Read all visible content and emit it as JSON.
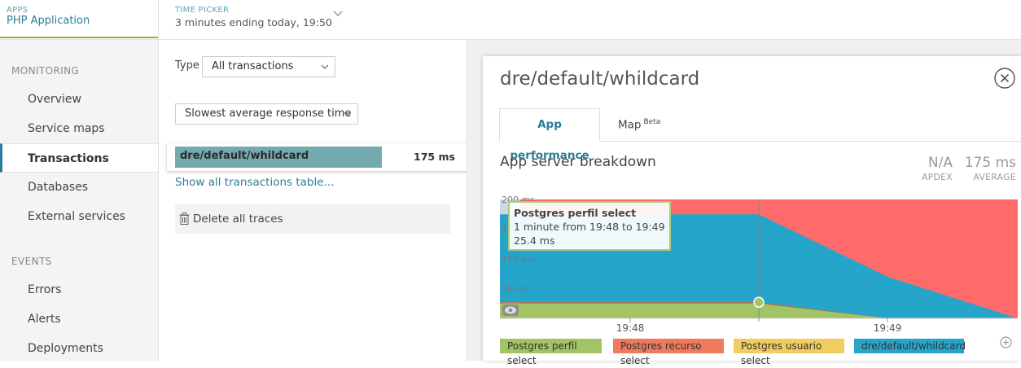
{
  "topbar": {
    "apps_label": "APPS",
    "apps_value": "PHP Application",
    "time_picker_label": "TIME PICKER",
    "time_picker_value": "3 minutes ending today, 19:50"
  },
  "sidebar": {
    "monitoring_header": "MONITORING",
    "monitoring_items": [
      {
        "label": "Overview"
      },
      {
        "label": "Service maps"
      },
      {
        "label": "Transactions",
        "active": true
      },
      {
        "label": "Databases"
      },
      {
        "label": "External services"
      }
    ],
    "events_header": "EVENTS",
    "events_items": [
      {
        "label": "Errors"
      },
      {
        "label": "Alerts"
      },
      {
        "label": "Deployments"
      }
    ]
  },
  "transactions": {
    "type_label": "Type",
    "type_select": "All transactions",
    "sort_select": "Slowest average response time",
    "rows": [
      {
        "name": "dre/default/whildcard",
        "value": "175 ms",
        "fill_fraction": 1.0
      }
    ],
    "show_all_link": "Show all transactions table...",
    "delete_traces": "Delete all traces"
  },
  "detail": {
    "title": "dre/default/whildcard",
    "tabs": [
      {
        "label": "App performance",
        "active": true
      },
      {
        "label": "Map",
        "badge": "Beta"
      }
    ],
    "breakdown_title": "App server breakdown",
    "apdex_value": "N/A",
    "apdex_label": "APDEX",
    "average_value": "175 ms",
    "average_label": "AVERAGE"
  },
  "chart_data": {
    "type": "area",
    "stacked": true,
    "y_unit": "ms",
    "y_ticks": [
      "50 ms",
      "100 ms",
      "150 ms",
      "200 ms"
    ],
    "ylim": [
      0,
      250
    ],
    "x_ticks": [
      "19:48",
      "19:49"
    ],
    "x": [
      "19:47:30",
      "19:48",
      "19:48:30",
      "19:49",
      "19:49:30",
      "19:50"
    ],
    "series": [
      {
        "name": "Postgres perfil select",
        "color": "#a3c464",
        "values": [
          25,
          25,
          25,
          25,
          0,
          0
        ]
      },
      {
        "name": "Postgres recurso select",
        "color": "#c4774f",
        "values": [
          2,
          2,
          2,
          2,
          0,
          0
        ]
      },
      {
        "name": "Postgres usuario select",
        "color": "#e8c953",
        "values": [
          0,
          0,
          0,
          0,
          0,
          0
        ]
      },
      {
        "name": "dre/default/whildcard",
        "color": "#25a5c9",
        "values": [
          148,
          148,
          148,
          148,
          70,
          0
        ]
      }
    ],
    "background_color": "#ff6b6b",
    "hover_x": "19:49",
    "tooltip": {
      "title": "Postgres perfil select",
      "subtitle": "1 minute from 19:48 to 19:49",
      "value": "25.4 ms"
    }
  }
}
